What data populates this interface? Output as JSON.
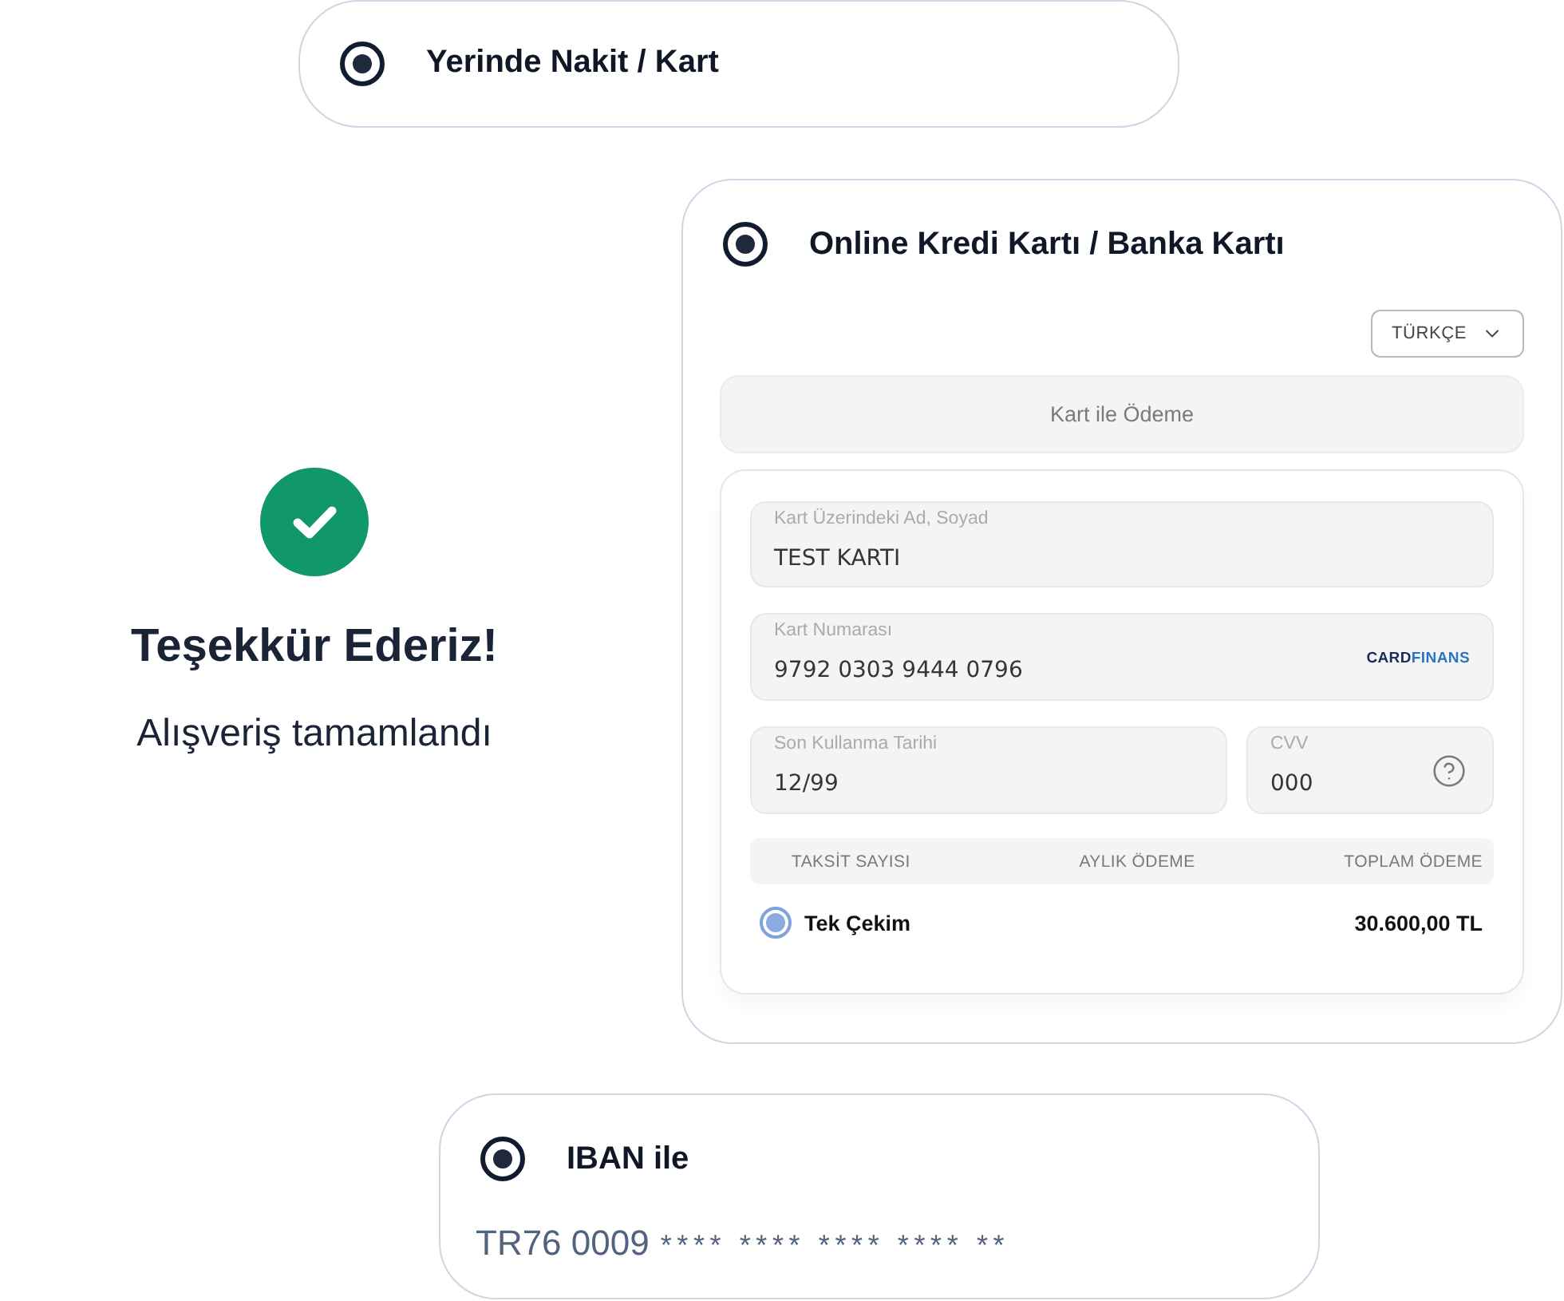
{
  "cash_option": {
    "label": "Yerinde Nakit / Kart",
    "selected": true
  },
  "success": {
    "title": "Teşekkür Ederiz!",
    "message": "Alışveriş tamamlandı"
  },
  "card_option": {
    "label": "Online Kredi Kartı / Banka Kartı",
    "selected": true,
    "language": "TÜRKÇE",
    "tab": "Kart ile Ödeme",
    "fields": [
      {
        "kind": "name",
        "label": "Kart Üzerindeki Ad, Soyad",
        "value": "TEST KARTI"
      },
      {
        "kind": "number",
        "label": "Kart Numarası",
        "value": "9792 0303 9444 0796",
        "brand": "CARDFINANS"
      },
      {
        "kind": "expiry",
        "label": "Son Kullanma Tarihi",
        "value": "12/99"
      },
      {
        "kind": "cvv",
        "label": "CVV",
        "value": "000"
      }
    ],
    "installments": {
      "columns": [
        "TAKSİT SAYISI",
        "AYLIK ÖDEME",
        "TOPLAM ÖDEME"
      ],
      "rows": [
        {
          "label": "Tek Çekim",
          "total": "30.600,00 TL",
          "selected": true
        }
      ]
    }
  },
  "iban_option": {
    "label": "IBAN ile",
    "selected": true,
    "iban": {
      "visible": "TR76 0009",
      "masked": "**** **** **** **** **"
    }
  }
}
